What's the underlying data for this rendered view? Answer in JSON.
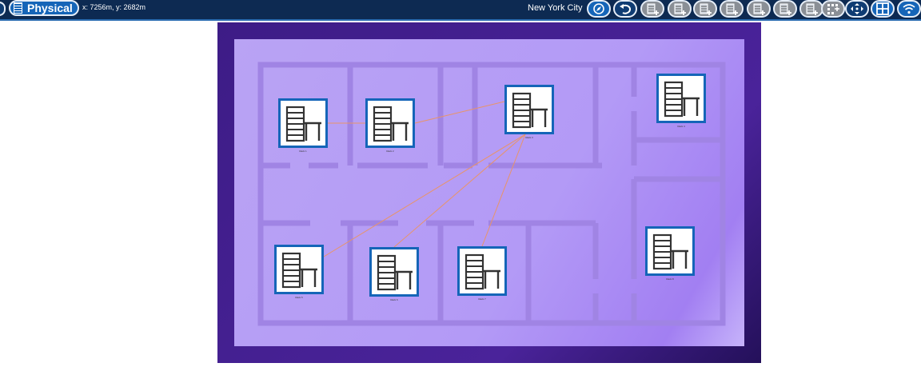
{
  "toolbar": {
    "view_label": "Physical",
    "coordinates": "x: 7256m, y: 2682m",
    "location": "New York City",
    "buttons": [
      {
        "name": "compass-icon"
      },
      {
        "name": "undo-icon"
      },
      {
        "name": "building-icon"
      },
      {
        "name": "add-rack-icon"
      },
      {
        "name": "add-device-icon"
      },
      {
        "name": "add-floor-device-icon"
      },
      {
        "name": "add-row-icon"
      },
      {
        "name": "add-panel-icon"
      },
      {
        "name": "report-icon"
      },
      {
        "name": "select-grid-icon"
      },
      {
        "name": "pan-icon"
      },
      {
        "name": "layout-icon"
      },
      {
        "name": "wifi-icon"
      }
    ]
  },
  "colors": {
    "toolbar_bg": "#0d2a52",
    "accent": "#1565b8",
    "floor": "#b39af6",
    "wall": "#a084e4",
    "stage": "#3d1c86",
    "link": "#e8946a"
  },
  "floorplan": {
    "devices": [
      {
        "id": "rack-1",
        "icon": "rack-icon",
        "label": "Rack 1"
      },
      {
        "id": "rack-2",
        "icon": "rack-icon",
        "label": "Rack 2"
      },
      {
        "id": "rack-3",
        "icon": "rack-icon",
        "label": "Rack 3"
      },
      {
        "id": "rack-4",
        "icon": "rack-icon",
        "label": "Rack 4"
      },
      {
        "id": "rack-5",
        "icon": "rack-icon",
        "label": "Rack 5"
      },
      {
        "id": "rack-6",
        "icon": "rack-icon",
        "label": "Rack 6"
      },
      {
        "id": "rack-7",
        "icon": "rack-icon",
        "label": "Rack 7"
      },
      {
        "id": "rack-8",
        "icon": "rack-icon",
        "label": "Rack 8"
      }
    ],
    "links": [
      {
        "from": "rack-1",
        "to": "rack-2"
      },
      {
        "from": "rack-2",
        "to": "rack-3"
      },
      {
        "from": "rack-5",
        "to": "rack-3"
      },
      {
        "from": "rack-6",
        "to": "rack-3"
      },
      {
        "from": "rack-7",
        "to": "rack-3"
      }
    ]
  }
}
